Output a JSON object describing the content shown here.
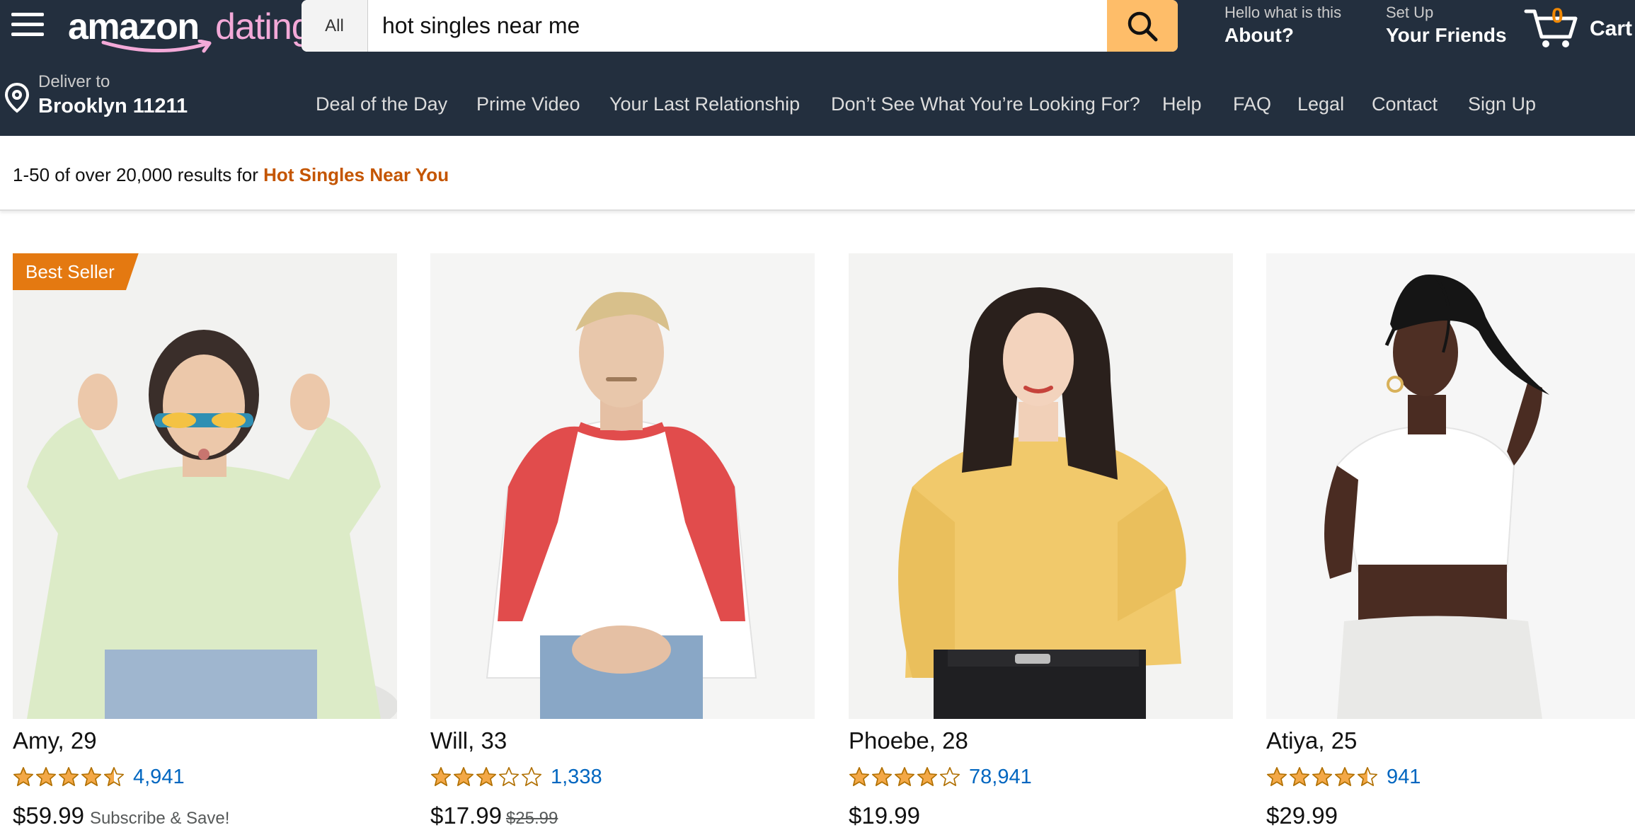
{
  "header": {
    "logo_main": "amazon",
    "logo_sub": "dating",
    "search": {
      "category": "All",
      "query": "hot singles near me"
    },
    "about": {
      "small": "Hello what is this",
      "big": "About?"
    },
    "friends": {
      "small": "Set Up",
      "big": "Your Friends"
    },
    "cart": {
      "count": "0",
      "label": "Cart"
    },
    "deliver": {
      "small": "Deliver to",
      "big": "Brooklyn 11211"
    },
    "nav": [
      "Deal of the Day",
      "Prime Video",
      "Your Last Relationship",
      "Don’t See What You’re Looking For?",
      "Help",
      "FAQ",
      "Legal",
      "Contact",
      "Sign Up"
    ]
  },
  "results": {
    "prefix": "1-50 of over 20,000 results for ",
    "query": "Hot Singles Near You"
  },
  "products": [
    {
      "name": "Amy, 29",
      "rating": 4.5,
      "reviews": "4,941",
      "price": "$59.99",
      "extra": "Subscribe & Save!",
      "badge": "Best Seller"
    },
    {
      "name": "Will, 33",
      "rating": 3,
      "reviews": "1,338",
      "price": "$17.99",
      "was": "$25.99"
    },
    {
      "name": "Phoebe, 28",
      "rating": 4,
      "reviews": "78,941",
      "price": "$19.99"
    },
    {
      "name": "Atiya, 25",
      "rating": 4.5,
      "reviews": "941",
      "price": "$29.99"
    }
  ],
  "colors": {
    "header_bg": "#232f3e",
    "search_button": "#febd69",
    "badge": "#e47911",
    "link": "#0066c0",
    "query_highlight": "#c45500",
    "star": "#f3a847"
  }
}
